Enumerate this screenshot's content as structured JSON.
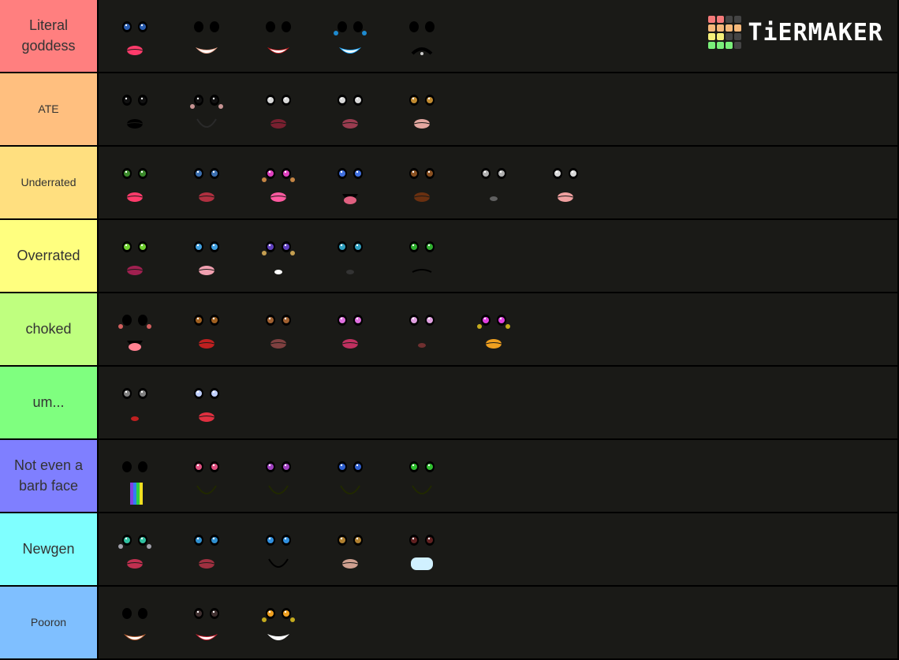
{
  "logo": {
    "text": "TiERMAKER",
    "grid_colors": [
      "#f47a7a",
      "#f47a7a",
      "#444444",
      "#444444",
      "#f5b87a",
      "#f5b87a",
      "#f5b87a",
      "#f5b87a",
      "#f5f07a",
      "#f5f07a",
      "#444444",
      "#444444",
      "#7aef7a",
      "#7aef7a",
      "#7aef7a",
      "#444444"
    ]
  },
  "tiers": [
    {
      "label": "Literal goddess",
      "color": "#ff7f7f",
      "font_size": "large",
      "faces": [
        {
          "name": "blue-eyes-pink-lips",
          "eye": "#2a5db0",
          "mouth": "#ff3b6b",
          "mouth_type": "lips"
        },
        {
          "name": "black-eyes-smile",
          "eye": "#000000",
          "mouth": "#e8a48c",
          "mouth_type": "smile"
        },
        {
          "name": "black-eyes-red-smile",
          "eye": "#000000",
          "mouth": "#c0191c",
          "mouth_type": "smile"
        },
        {
          "name": "blue-sparkle-smile",
          "eye": "#000000",
          "mouth": "#1fa8ff",
          "mouth_type": "smile",
          "accent": "#1fa8ff"
        },
        {
          "name": "angry-black-face",
          "eye": "#000000",
          "mouth": "#000000",
          "mouth_type": "frown"
        }
      ]
    },
    {
      "label": "ATE",
      "color": "#ffbf7f",
      "font_size": "small",
      "faces": [
        {
          "name": "black-lips-closed-eyes",
          "eye": "#111111",
          "mouth": "#000000",
          "mouth_type": "lips"
        },
        {
          "name": "blush-smile",
          "eye": "#111111",
          "mouth": "#2a2a2a",
          "mouth_type": "arc",
          "accent": "#f2b3b3"
        },
        {
          "name": "dark-makeup-face",
          "eye": "#d8d8d8",
          "mouth": "#7a2030",
          "mouth_type": "lips"
        },
        {
          "name": "blue-shadow-face",
          "eye": "#d8d8d8",
          "mouth": "#9b3c50",
          "mouth_type": "lips"
        },
        {
          "name": "hazel-eyes-freckle",
          "eye": "#c08a30",
          "mouth": "#e3a7a0",
          "mouth_type": "lips"
        }
      ]
    },
    {
      "label": "Underrated",
      "color": "#ffdf7f",
      "font_size": "small",
      "faces": [
        {
          "name": "green-eyes-pink-lips",
          "eye": "#3a8a2a",
          "mouth": "#ff3b6b",
          "mouth_type": "lips"
        },
        {
          "name": "blue-eyes-small-lips",
          "eye": "#3b6fb0",
          "mouth": "#b03040",
          "mouth_type": "lips"
        },
        {
          "name": "pink-anime-eyes",
          "eye": "#e040c0",
          "mouth": "#ff5aa0",
          "mouth_type": "lips",
          "accent": "#f0a050"
        },
        {
          "name": "big-blue-anime-eyes",
          "eye": "#4070e0",
          "mouth": "#e06080",
          "mouth_type": "open"
        },
        {
          "name": "brown-eyes-face",
          "eye": "#8a5020",
          "mouth": "#6a3010",
          "mouth_type": "lips"
        },
        {
          "name": "grey-mime-face",
          "eye": "#b0b0b0",
          "mouth": "#606060",
          "mouth_type": "small"
        },
        {
          "name": "black-eyes-pink-lips",
          "eye": "#d8d8d8",
          "mouth": "#f0a0a0",
          "mouth_type": "lips"
        }
      ]
    },
    {
      "label": "Overrated",
      "color": "#ffff7f",
      "font_size": "large",
      "faces": [
        {
          "name": "green-gradient-eyes",
          "eye": "#70d030",
          "mouth": "#a02050",
          "mouth_type": "lips"
        },
        {
          "name": "blue-eyes-pink-lips-2",
          "eye": "#40a0e0",
          "mouth": "#f0a0b0",
          "mouth_type": "lips"
        },
        {
          "name": "purple-eye-wink",
          "eye": "#6040c0",
          "mouth": "#ffffff",
          "mouth_type": "small",
          "accent": "#f0c060"
        },
        {
          "name": "teal-angry-eyes",
          "eye": "#30a0c0",
          "mouth": "#333333",
          "mouth_type": "small"
        },
        {
          "name": "green-eyes-frown",
          "eye": "#30b030",
          "mouth": "#000000",
          "mouth_type": "line"
        }
      ]
    },
    {
      "label": "choked",
      "color": "#bfff7f",
      "font_size": "large",
      "faces": [
        {
          "name": "blush-open-mouth",
          "eye": "#000000",
          "mouth": "#ff8090",
          "mouth_type": "open",
          "accent": "#ff7070"
        },
        {
          "name": "brown-eyes-red-lips",
          "eye": "#a06020",
          "mouth": "#c02020",
          "mouth_type": "lips"
        },
        {
          "name": "brown-eyes-sprinkles",
          "eye": "#a06030",
          "mouth": "#804040",
          "mouth_type": "lips"
        },
        {
          "name": "pink-glitter-eyes",
          "eye": "#e070e0",
          "mouth": "#c03060",
          "mouth_type": "lips"
        },
        {
          "name": "pink-flower-eyes",
          "eye": "#e0a0e0",
          "mouth": "#703030",
          "mouth_type": "small"
        },
        {
          "name": "rainbow-eyes",
          "eye": "#e040e0",
          "mouth": "#f0a020",
          "mouth_type": "lips",
          "accent": "#f0d020"
        }
      ]
    },
    {
      "label": "um...",
      "color": "#7fff7f",
      "font_size": "large",
      "faces": [
        {
          "name": "doll-stitch-face",
          "eye": "#808080",
          "mouth": "#c02020",
          "mouth_type": "small"
        },
        {
          "name": "purple-eyes-red-lips",
          "eye": "#c0d0ff",
          "mouth": "#e03040",
          "mouth_type": "lips"
        }
      ]
    },
    {
      "label": "Not even a barb face",
      "color": "#7f7fff",
      "font_size": "large",
      "faces": [
        {
          "name": "rainbow-tongue-face",
          "eye": "#000000",
          "mouth": "rainbow",
          "mouth_type": "rainbow"
        },
        {
          "name": "pink-dot-eyes-smile",
          "eye": "#e05080",
          "mouth": "#202800",
          "mouth_type": "arc"
        },
        {
          "name": "purple-dot-eyes-smile",
          "eye": "#a040c0",
          "mouth": "#202800",
          "mouth_type": "arc"
        },
        {
          "name": "blue-dot-eyes-smile",
          "eye": "#3060d0",
          "mouth": "#202800",
          "mouth_type": "arc"
        },
        {
          "name": "green-dot-eyes-smile",
          "eye": "#30c030",
          "mouth": "#202800",
          "mouth_type": "arc"
        }
      ]
    },
    {
      "label": "Newgen",
      "color": "#7fffff",
      "font_size": "large",
      "faces": [
        {
          "name": "teal-gem-eyes",
          "eye": "#30c0a0",
          "mouth": "#c03050",
          "mouth_type": "lips",
          "accent": "#c0c0d0"
        },
        {
          "name": "blue-shadow-butterfly",
          "eye": "#3090d0",
          "mouth": "#a03040",
          "mouth_type": "lips"
        },
        {
          "name": "blue-eyes-lashes",
          "eye": "#3090e0",
          "mouth": "#000000",
          "mouth_type": "arc"
        },
        {
          "name": "golden-eyes-face",
          "eye": "#b08030",
          "mouth": "#d0a090",
          "mouth_type": "lips"
        },
        {
          "name": "glowing-teeth-face",
          "eye": "#602020",
          "mouth": "#d0f0ff",
          "mouth_type": "teeth"
        }
      ]
    },
    {
      "label": "Pooron",
      "color": "#7fbfff",
      "font_size": "small",
      "faces": [
        {
          "name": "classic-smile",
          "eye": "#000000",
          "mouth": "#c06030",
          "mouth_type": "smile"
        },
        {
          "name": "red-lips-grin",
          "eye": "#403030",
          "mouth": "#d02030",
          "mouth_type": "smile"
        },
        {
          "name": "star-eyes-grin",
          "eye": "#f0a020",
          "mouth": "#ffffff",
          "mouth_type": "smile",
          "accent": "#f0d020"
        }
      ]
    }
  ]
}
